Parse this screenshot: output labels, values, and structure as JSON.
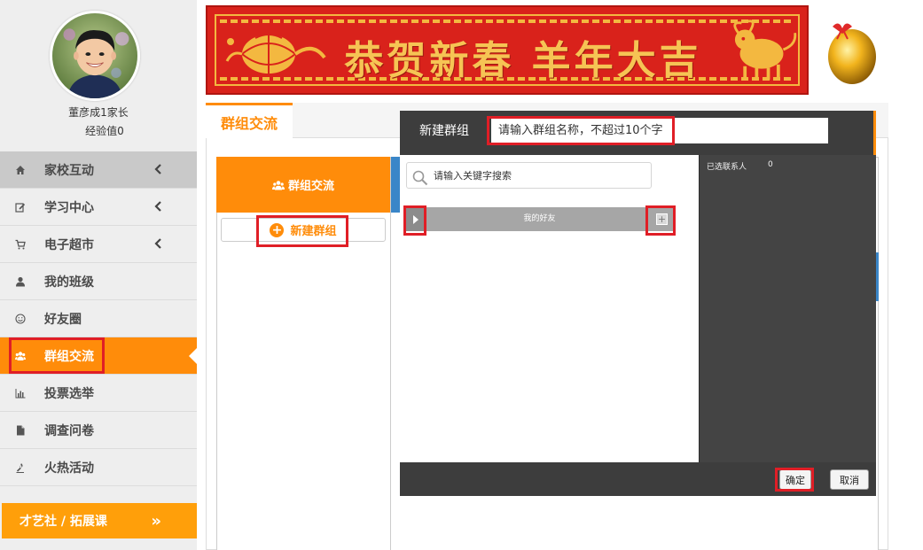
{
  "user": {
    "name": "董彦成1家长",
    "experience": "经验值0"
  },
  "menu": [
    {
      "label": "家校互动",
      "icon": "home-icon",
      "has_chevron": true
    },
    {
      "label": "学习中心",
      "icon": "edit-icon",
      "has_chevron": true
    },
    {
      "label": "电子超市",
      "icon": "cart-icon",
      "has_chevron": true
    },
    {
      "label": "我的班级",
      "icon": "user-icon",
      "has_chevron": false
    },
    {
      "label": "好友圈",
      "icon": "smile-icon",
      "has_chevron": false
    },
    {
      "label": "群组交流",
      "icon": "users-icon",
      "has_chevron": false,
      "active": true
    },
    {
      "label": "投票选举",
      "icon": "bar-chart-icon",
      "has_chevron": false
    },
    {
      "label": "调查问卷",
      "icon": "file-icon",
      "has_chevron": false
    },
    {
      "label": "火热活动",
      "icon": "torch-icon",
      "has_chevron": false
    }
  ],
  "promo": {
    "label": "才艺社 / 拓展课",
    "arrow": "»"
  },
  "banner": {
    "text": "恭贺新春 羊年大吉"
  },
  "main": {
    "tab_label": "群组交流",
    "panel_title": "群组交流",
    "new_group_label": "新建群组"
  },
  "modal": {
    "title": "新建群组",
    "name_placeholder": "请输入群组名称，不超过10个字",
    "search_placeholder": "请输入关键字搜索",
    "group_label": "我的好友",
    "add_all_symbol": "+",
    "selected_label": "已选联系人",
    "selected_count": "0",
    "ok_label": "确定",
    "cancel_label": "取消"
  },
  "colors": {
    "accent": "#ff8c0a",
    "highlight": "#e01e26",
    "banner_red": "#d9221b",
    "modal_dark": "#3d3d3d"
  }
}
